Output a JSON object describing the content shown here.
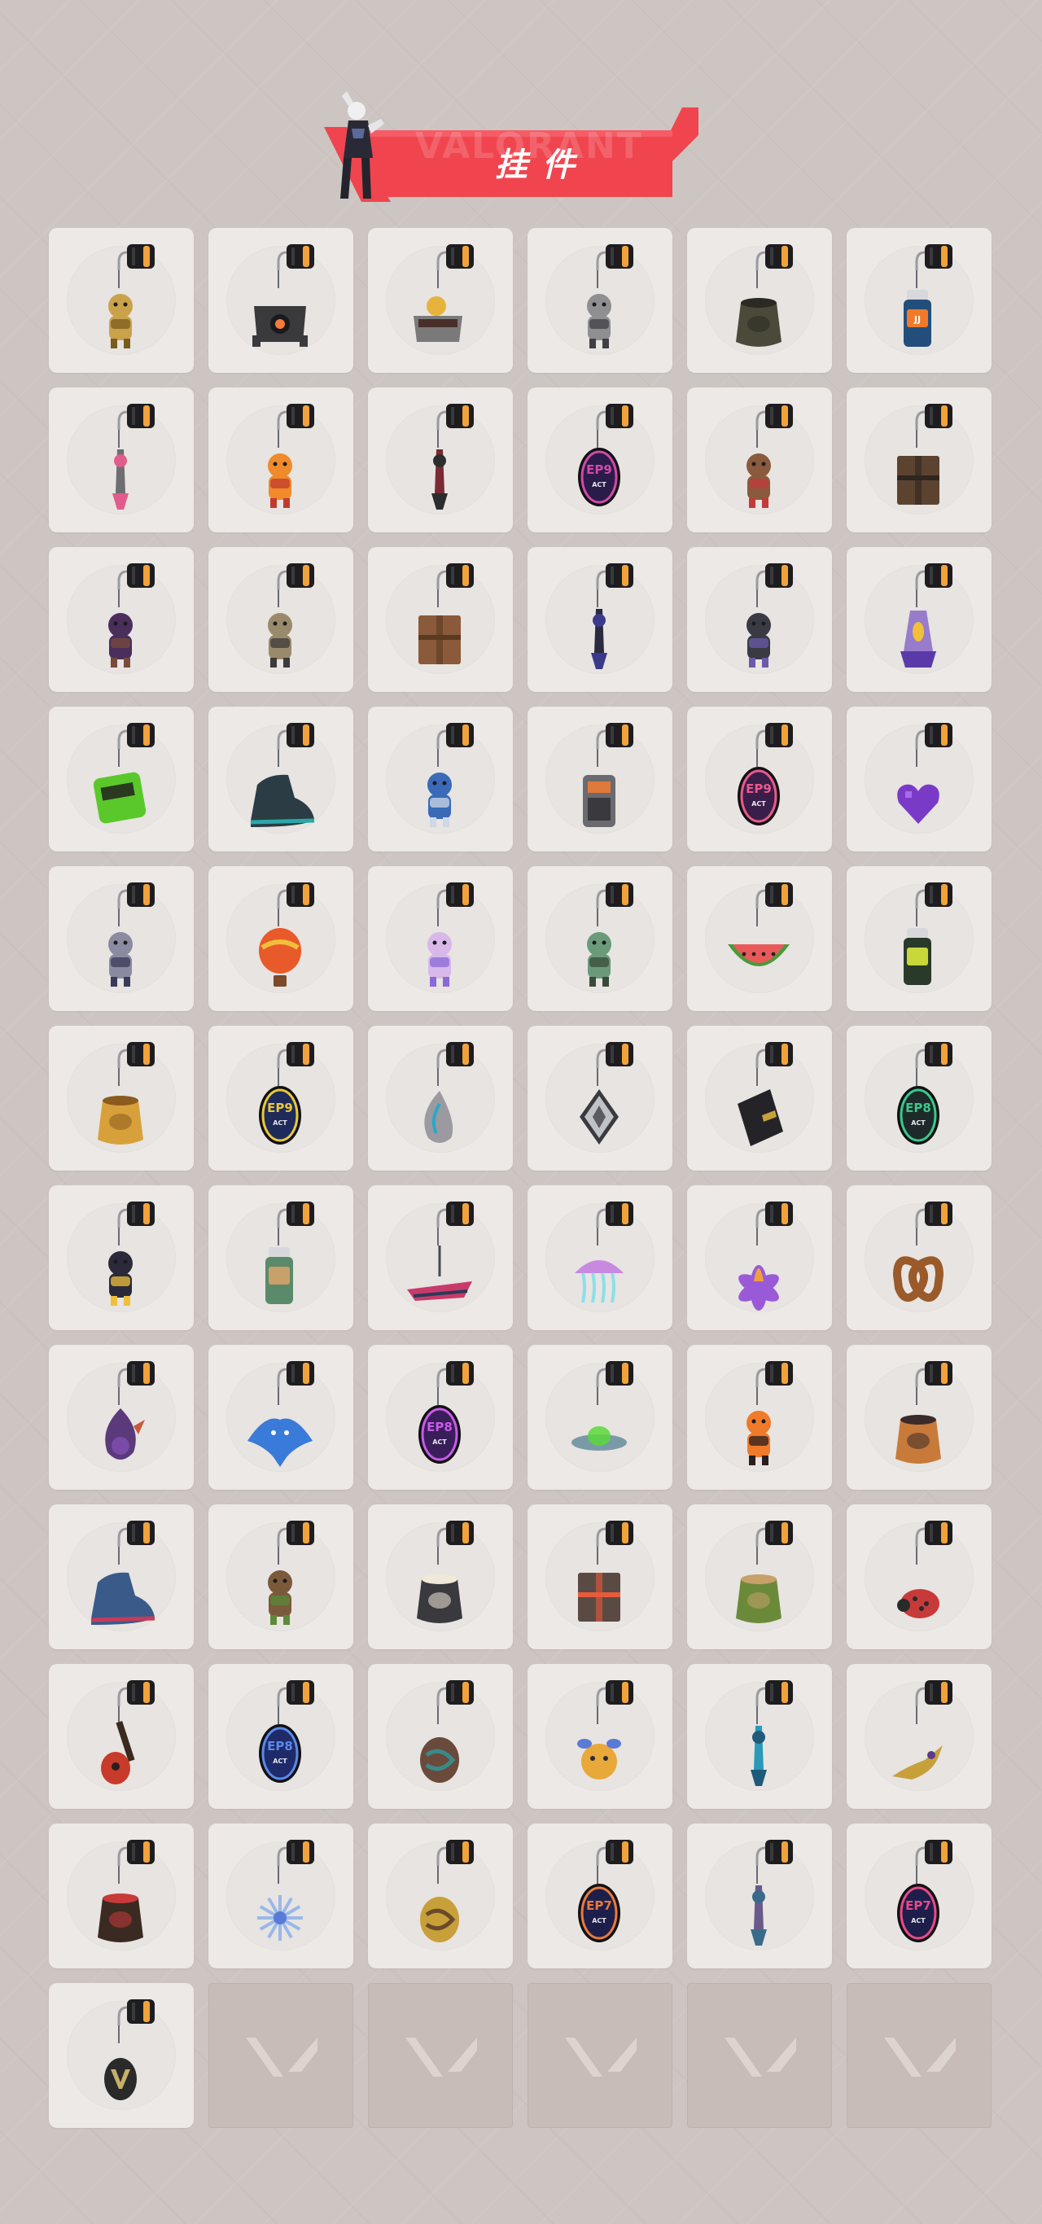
{
  "title": "挂件",
  "watermark": "VALORANT",
  "colors": {
    "background": "#cdc5c1",
    "tile": "#ece9e6",
    "tile_empty": "#c7bcb7",
    "banner_red": "#f0454f",
    "clip_black": "#1d1d1f",
    "clip_gold": "#f2a23a"
  },
  "grid": {
    "columns": 6,
    "rows": 12
  },
  "buddies": [
    {
      "icon": "lucky-cat-charm-icon",
      "color": "#c9a24a",
      "accent": "#7a5c1f",
      "shape": "cat",
      "labels": []
    },
    {
      "icon": "robot-spike-charm-icon",
      "color": "#3a3a3c",
      "accent": "#f57b3a",
      "shape": "robot",
      "labels": []
    },
    {
      "icon": "rubber-duck-tub-charm-icon",
      "color": "#e6b43c",
      "accent": "#7a7a7a",
      "shape": "tub",
      "labels": []
    },
    {
      "icon": "raccoon-charm-icon",
      "color": "#8f8f92",
      "accent": "#3f3f44",
      "shape": "creature",
      "labels": []
    },
    {
      "icon": "canteen-bag-charm-icon",
      "color": "#4b4a3a",
      "accent": "#2b2a22",
      "shape": "bag",
      "labels": []
    },
    {
      "icon": "battery-canister-charm-icon",
      "color": "#234e7c",
      "accent": "#f07a2a",
      "shape": "bottle",
      "labels": [
        "JJ"
      ]
    },
    {
      "icon": "chainsaw-blade-charm-icon",
      "color": "#6c6e70",
      "accent": "#e05c8a",
      "shape": "blade",
      "labels": []
    },
    {
      "icon": "candy-corn-charm-icon",
      "color": "#f08a2a",
      "accent": "#c23a2f",
      "shape": "candy",
      "labels": []
    },
    {
      "icon": "paracord-charm-icon",
      "color": "#7a2a34",
      "accent": "#2d2d2d",
      "shape": "cord",
      "labels": []
    },
    {
      "icon": "ep9-act-badge-charm-icon",
      "color": "#2b1b4a",
      "accent": "#d04aa8",
      "shape": "badge",
      "labels": [
        "EP9",
        "ACT"
      ]
    },
    {
      "icon": "teddy-bear-bell-charm-icon",
      "color": "#8a5a3c",
      "accent": "#c23a3a",
      "shape": "bear",
      "labels": []
    },
    {
      "icon": "wooden-drone-charm-icon",
      "color": "#5c4330",
      "accent": "#2e2620",
      "shape": "box",
      "labels": []
    },
    {
      "icon": "agent-figurine-charm-icon",
      "color": "#4a2e5c",
      "accent": "#7a4a3a",
      "shape": "figure",
      "labels": []
    },
    {
      "icon": "masked-agent-figurine-charm-icon",
      "color": "#9a8a6c",
      "accent": "#3c3a3a",
      "shape": "figure",
      "labels": []
    },
    {
      "icon": "wooden-crate-charm-icon",
      "color": "#8a5a3a",
      "accent": "#5a3a22",
      "shape": "crate",
      "labels": []
    },
    {
      "icon": "tassel-mask-charm-icon",
      "color": "#2a2a3e",
      "accent": "#3a3a8a",
      "shape": "tassel",
      "labels": []
    },
    {
      "icon": "dark-critter-charm-icon",
      "color": "#3a3a44",
      "accent": "#6a5aa8",
      "shape": "creature",
      "labels": []
    },
    {
      "icon": "lava-lamp-charm-icon",
      "color": "#8a6ac8",
      "accent": "#f0c03a",
      "shape": "lamp",
      "labels": []
    },
    {
      "icon": "pager-charm-icon",
      "color": "#5ac82a",
      "accent": "#2a3a1e",
      "shape": "pager",
      "labels": []
    },
    {
      "icon": "sneaker-charm-icon",
      "color": "#2c3c44",
      "accent": "#2aa8a8",
      "shape": "shoe",
      "labels": []
    },
    {
      "icon": "astronaut-charm-icon",
      "color": "#3a6ab8",
      "accent": "#cfd8e8",
      "shape": "figure",
      "labels": []
    },
    {
      "icon": "walkie-talkie-charm-icon",
      "color": "#6a6a70",
      "accent": "#e07a3a",
      "shape": "radio",
      "labels": []
    },
    {
      "icon": "ep9-act-badge-pink-charm-icon",
      "color": "#3a1e4a",
      "accent": "#e85a8a",
      "shape": "badge",
      "labels": [
        "EP9",
        "ACT"
      ]
    },
    {
      "icon": "pixel-heart-charm-icon",
      "color": "#7a3ac8",
      "accent": "#4a1e8a",
      "shape": "heart",
      "labels": []
    },
    {
      "icon": "pixel-agent-charm-icon",
      "color": "#8a8aa0",
      "accent": "#3a3a5a",
      "shape": "figure",
      "labels": []
    },
    {
      "icon": "hot-air-balloon-charm-icon",
      "color": "#e85a2a",
      "accent": "#f0c03a",
      "shape": "balloon",
      "labels": []
    },
    {
      "icon": "anime-agent-charm-icon",
      "color": "#d8b8e8",
      "accent": "#8a6ad8",
      "shape": "figure",
      "labels": []
    },
    {
      "icon": "zombie-toaster-charm-icon",
      "color": "#6a9a7a",
      "accent": "#3a4a3a",
      "shape": "creature",
      "labels": []
    },
    {
      "icon": "watermelon-slice-charm-icon",
      "color": "#e85a5a",
      "accent": "#4a9a3a",
      "shape": "melon",
      "labels": []
    },
    {
      "icon": "energy-can-charm-icon",
      "color": "#2a3a2a",
      "accent": "#c8d83a",
      "shape": "bottle",
      "labels": []
    },
    {
      "icon": "beehive-charm-icon",
      "color": "#d8a03a",
      "accent": "#8a5a1e",
      "shape": "hive",
      "labels": []
    },
    {
      "icon": "ep9-act-badge-blue-charm-icon",
      "color": "#1e2a5a",
      "accent": "#e8c83a",
      "shape": "badge",
      "labels": [
        "EP9",
        "ACT"
      ]
    },
    {
      "icon": "swirl-shell-charm-icon",
      "color": "#9a9aa0",
      "accent": "#2aa8c8",
      "shape": "shell",
      "labels": []
    },
    {
      "icon": "silver-diamond-charm-icon",
      "color": "#bfc2c6",
      "accent": "#5a5c60",
      "shape": "diamond",
      "labels": []
    },
    {
      "icon": "black-card-charm-icon",
      "color": "#242428",
      "accent": "#c8a03a",
      "shape": "card",
      "labels": []
    },
    {
      "icon": "ep8-act-badge-green-charm-icon",
      "color": "#1e2a2a",
      "accent": "#3ac88a",
      "shape": "badge",
      "labels": [
        "EP8",
        "ACT"
      ]
    },
    {
      "icon": "penguin-claw-charm-icon",
      "color": "#2a2a3a",
      "accent": "#f0c03a",
      "shape": "creature",
      "labels": []
    },
    {
      "icon": "message-bottle-charm-icon",
      "color": "#5a8a6a",
      "accent": "#c8a06a",
      "shape": "bottle",
      "labels": []
    },
    {
      "icon": "jet-ski-charm-icon",
      "color": "#c83a6a",
      "accent": "#2a3a5a",
      "shape": "boat",
      "labels": []
    },
    {
      "icon": "jellyfish-ufo-charm-icon",
      "color": "#8ae0e8",
      "accent": "#c88ae0",
      "shape": "jelly",
      "labels": []
    },
    {
      "icon": "lotus-flame-charm-icon",
      "color": "#9a5ad8",
      "accent": "#f0a03a",
      "shape": "flower",
      "labels": []
    },
    {
      "icon": "pretzel-charm-icon",
      "color": "#9a5a2a",
      "accent": "#f0e0c0",
      "shape": "pretzel",
      "labels": []
    },
    {
      "icon": "eye-orb-charm-icon",
      "color": "#5a3a7a",
      "accent": "#c85a3a",
      "shape": "orb",
      "labels": []
    },
    {
      "icon": "manta-ray-charm-icon",
      "color": "#3a7ad8",
      "accent": "#2a3a8a",
      "shape": "manta",
      "labels": []
    },
    {
      "icon": "ep8-act-badge-purple-charm-icon",
      "color": "#3a1e5a",
      "accent": "#c85ae8",
      "shape": "badge",
      "labels": [
        "EP8",
        "ACT"
      ]
    },
    {
      "icon": "ufo-saucer-charm-icon",
      "color": "#7a9aa8",
      "accent": "#5ad83a",
      "shape": "ufo",
      "labels": []
    },
    {
      "icon": "tiger-plush-charm-icon",
      "color": "#f07a2a",
      "accent": "#2a1e1e",
      "shape": "creature",
      "labels": []
    },
    {
      "icon": "bread-dumpling-charm-icon",
      "color": "#c87a3a",
      "accent": "#3a2a2a",
      "shape": "bun",
      "labels": []
    },
    {
      "icon": "blue-sneaker-charm-icon",
      "color": "#3a5a8a",
      "accent": "#c83a5a",
      "shape": "shoe",
      "labels": []
    },
    {
      "icon": "tiki-bear-charm-icon",
      "color": "#7a5a3a",
      "accent": "#5a8a3a",
      "shape": "bear",
      "labels": []
    },
    {
      "icon": "frying-pan-charm-icon",
      "color": "#3a3a3e",
      "accent": "#f0e8d8",
      "shape": "pan",
      "labels": []
    },
    {
      "icon": "target-cube-charm-icon",
      "color": "#5a4a44",
      "accent": "#e85a3a",
      "shape": "box",
      "labels": []
    },
    {
      "icon": "plant-pot-charm-icon",
      "color": "#6a8a3a",
      "accent": "#c8a06a",
      "shape": "plant",
      "labels": []
    },
    {
      "icon": "ladybug-charm-icon",
      "color": "#c83a3a",
      "accent": "#2a2a2a",
      "shape": "bug",
      "labels": []
    },
    {
      "icon": "guitar-charm-icon",
      "color": "#c83a2a",
      "accent": "#3a2a1e",
      "shape": "guitar",
      "labels": []
    },
    {
      "icon": "ep8-act-badge-blue-charm-icon",
      "color": "#1e2a6a",
      "accent": "#5a8ae8",
      "shape": "badge",
      "labels": [
        "EP8",
        "ACT"
      ]
    },
    {
      "icon": "swirl-medallion-charm-icon",
      "color": "#6a4a3a",
      "accent": "#3a8a8a",
      "shape": "medallion",
      "labels": []
    },
    {
      "icon": "bee-ball-charm-icon",
      "color": "#e8a83a",
      "accent": "#2a2a3a",
      "shape": "bee",
      "labels": []
    },
    {
      "icon": "treble-clef-charm-icon",
      "color": "#2a9ab8",
      "accent": "#1e5a7a",
      "shape": "clef",
      "labels": []
    },
    {
      "icon": "genie-lamp-charm-icon",
      "color": "#c8a03a",
      "accent": "#5a3a8a",
      "shape": "lamp2",
      "labels": []
    },
    {
      "icon": "lantern-basket-charm-icon",
      "color": "#3a2a22",
      "accent": "#c83a3a",
      "shape": "basket",
      "labels": []
    },
    {
      "icon": "snowflake-charm-icon",
      "color": "#9ab8e8",
      "accent": "#5a7ad8",
      "shape": "snow",
      "labels": []
    },
    {
      "icon": "gold-medallion-charm-icon",
      "color": "#c8a03a",
      "accent": "#6a4a2a",
      "shape": "medallion",
      "labels": []
    },
    {
      "icon": "ep7-act-badge-orange-charm-icon",
      "color": "#1e1e4a",
      "accent": "#e87a3a",
      "shape": "badge",
      "labels": [
        "EP7",
        "ACT"
      ]
    },
    {
      "icon": "jade-tassel-charm-icon",
      "color": "#6a5a8a",
      "accent": "#3a6a8a",
      "shape": "tassel",
      "labels": []
    },
    {
      "icon": "ep7-act-badge-pink-charm-icon",
      "color": "#1e1e4a",
      "accent": "#e84a8a",
      "shape": "badge",
      "labels": [
        "EP7",
        "ACT"
      ]
    },
    {
      "icon": "valorant-v-tag-charm-icon",
      "color": "#2a2a2a",
      "accent": "#c8b06a",
      "shape": "vtag",
      "labels": []
    }
  ],
  "empty_slot_icon": "valorant-logo-icon",
  "empty_slots": 5
}
